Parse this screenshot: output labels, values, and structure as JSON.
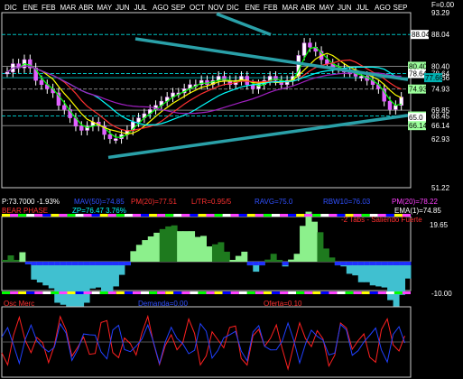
{
  "chart_data": [
    {
      "type": "candlestick",
      "months_top": [
        "DIC",
        "ENE",
        "FEB",
        "MAR",
        "ABR",
        "MAY",
        "JUN",
        "JUL",
        "AGO",
        "SEP",
        "OCT",
        "NOV",
        "DIC",
        "ENE",
        "FEB",
        "MAR",
        "ABR",
        "MAY",
        "JUN",
        "JUL",
        "AGO",
        "SEP"
      ],
      "y_ticks": [
        "F=0.00",
        "93.29",
        "88.04",
        "80.40",
        "78.64",
        "77.66",
        "74.93",
        "69.85",
        "68.45",
        "66.14",
        "62.93",
        "51.22"
      ],
      "tags": [
        {
          "text": "88.04",
          "color": "#ffffff"
        },
        {
          "text": "80.40",
          "color": "#9cff9c"
        },
        {
          "text": "78.64",
          "color": "#ffffff"
        },
        {
          "text": "77.66",
          "color": "#00b0b0"
        },
        {
          "text": "74.93",
          "color": "#9cff9c"
        },
        {
          "text": "68.45",
          "color": "#9cff9c"
        },
        {
          "text": "65.0",
          "color": "#ffffff"
        },
        {
          "text": "66.14",
          "color": "#9cff9c"
        }
      ],
      "close": [
        79,
        81,
        80,
        82,
        80,
        77,
        76,
        75,
        74,
        71,
        70,
        68,
        66,
        65,
        66,
        67,
        66,
        64,
        63,
        63,
        64,
        65,
        67,
        68,
        69,
        70,
        71,
        72,
        73,
        74,
        74,
        75,
        76,
        76,
        77,
        76,
        77,
        78,
        77,
        76,
        77,
        78,
        76,
        75,
        76,
        77,
        78,
        77,
        76,
        77,
        78,
        83,
        86,
        85,
        84,
        82,
        81,
        80,
        80,
        79,
        79,
        78,
        78,
        77,
        76,
        75,
        72,
        70,
        71,
        73
      ]
    },
    {
      "type": "area",
      "title": "-2 Tabs - Saliendo Fuerte",
      "y_ticks": [
        "19.65",
        "-10.00"
      ]
    },
    {
      "type": "line",
      "series": [
        {
          "name": "Osc Merc",
          "color": "#ff2020"
        },
        {
          "name": "Demanda=0.00",
          "color": "#2040ff"
        },
        {
          "name": "Oferta=0.10",
          "color": "#ff2020"
        }
      ]
    }
  ],
  "info_row1": [
    {
      "text": "P:73.7000 -1.93%",
      "color": "#ffffff"
    },
    {
      "text": "MAV(50)=74.85",
      "color": "#3050ff"
    },
    {
      "text": "PM(20)=77.51",
      "color": "#ff3030"
    },
    {
      "text": "L/TR=0.95/5",
      "color": "#ff3030"
    },
    {
      "text": "RAVG=75.0",
      "color": "#3050ff"
    },
    {
      "text": "RBW10=76.03",
      "color": "#3050ff"
    },
    {
      "text": "PM(20)=78.22",
      "color": "#ff40ff"
    }
  ],
  "info_row2": [
    {
      "text": "BEAR PHASE",
      "color": "#ff3030"
    },
    {
      "text": "ZP=76.47  3.76%",
      "color": "#00ffff"
    },
    {
      "text": "EMA(1)=74.85",
      "color": "#ffffff"
    }
  ]
}
